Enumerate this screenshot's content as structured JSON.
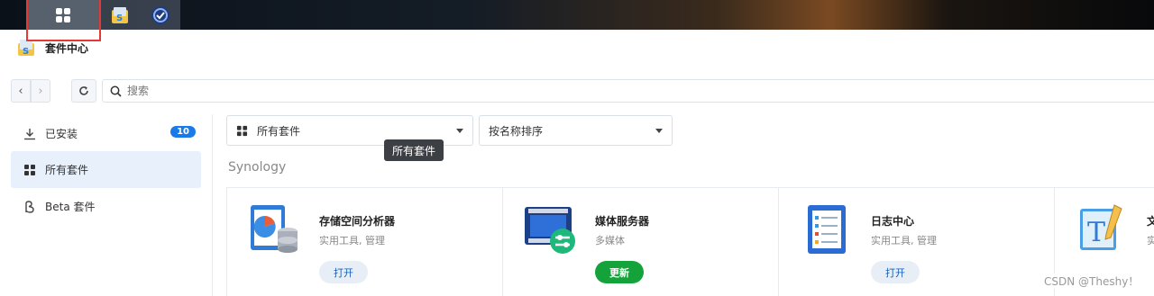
{
  "taskbar": {
    "items": [
      {
        "icon": "main-menu-icon"
      },
      {
        "icon": "package-center-icon"
      },
      {
        "icon": "task-app-icon"
      }
    ]
  },
  "window": {
    "title": "套件中心",
    "icon": "package-center-icon"
  },
  "toolbar": {
    "search_placeholder": "搜索"
  },
  "sidebar": {
    "items": [
      {
        "label": "已安装",
        "icon": "download-icon",
        "badge": "10",
        "active": false
      },
      {
        "label": "所有套件",
        "icon": "grid-icon",
        "active": true
      },
      {
        "label": "Beta 套件",
        "icon": "beta-icon",
        "active": false
      }
    ]
  },
  "filters": {
    "category": "所有套件",
    "sort": "按名称排序",
    "tooltip": "所有套件"
  },
  "section": {
    "title": "Synology"
  },
  "packages": [
    {
      "name": "存储空间分析器",
      "category": "实用工具, 管理",
      "action": "打开",
      "action_type": "open",
      "icon": "storage-analyzer-icon"
    },
    {
      "name": "媒体服务器",
      "category": "多媒体",
      "action": "更新",
      "action_type": "update",
      "icon": "media-server-icon"
    },
    {
      "name": "日志中心",
      "category": "实用工具, 管理",
      "action": "打开",
      "action_type": "open",
      "icon": "log-center-icon"
    },
    {
      "name": "文",
      "category": "实",
      "action": "",
      "action_type": "partial",
      "icon": "text-editor-icon"
    }
  ],
  "watermark": "CSDN @Theshy！",
  "colors": {
    "accent": "#1a7ae8",
    "update_green": "#14a33a",
    "highlight_red": "#e53935"
  }
}
